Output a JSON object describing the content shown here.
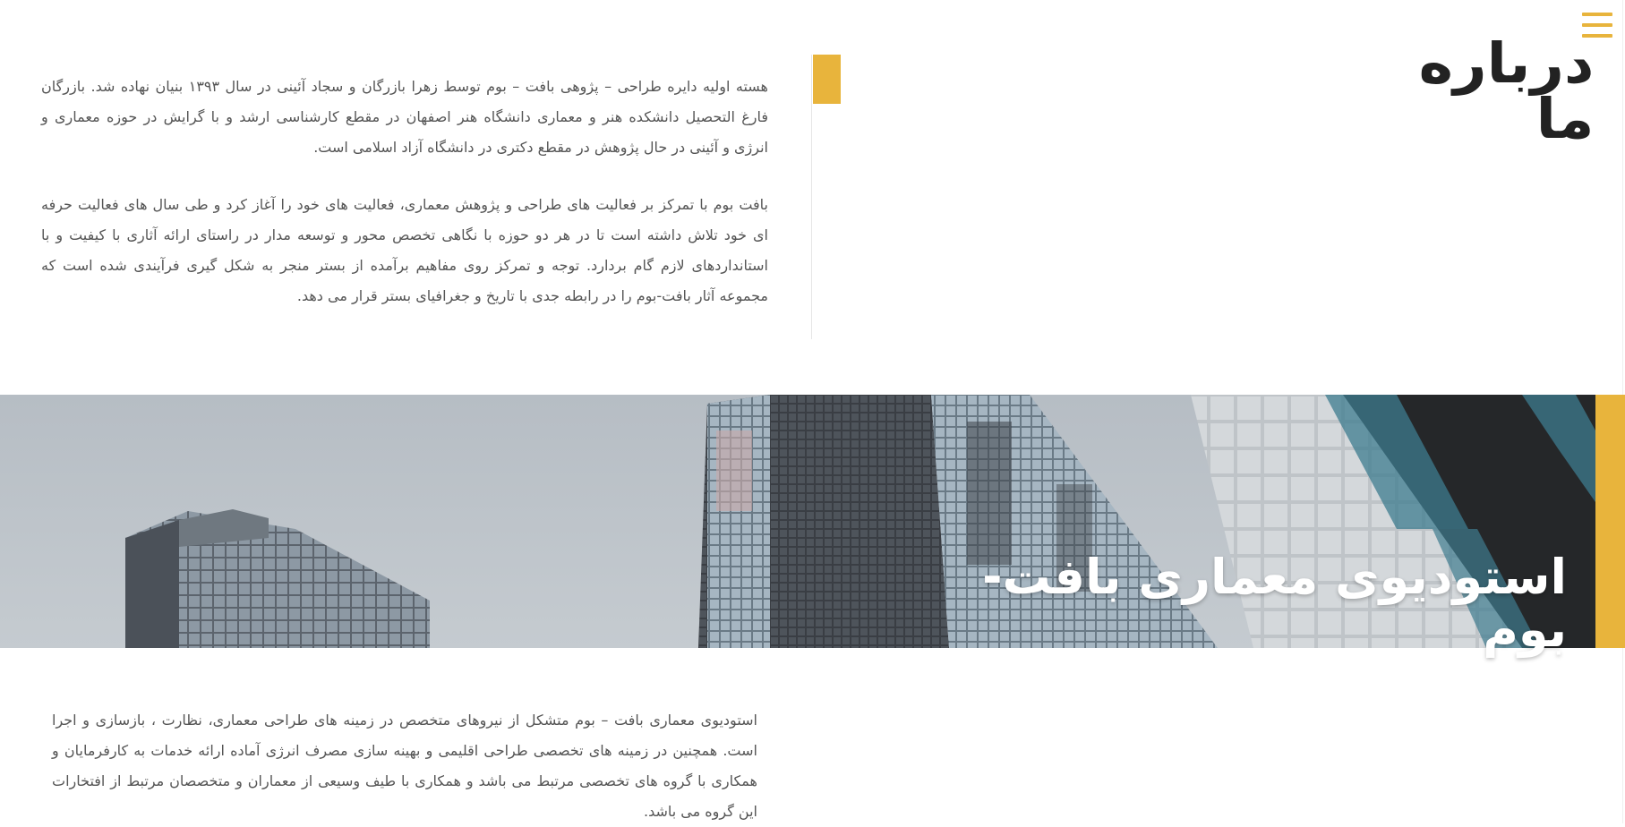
{
  "header": {
    "menu_icon": "hamburger-menu-icon"
  },
  "about": {
    "title": "درباره ما",
    "paragraphs": [
      "هسته اولیه دایره طراحی – پژوهی بافت – بوم توسط زهرا بازرگان و سجاد آئینی در سال ۱۳۹۳ بنیان نهاده شد. بازرگان فارغ التحصیل دانشکده هنر و معماری دانشگاه هنر اصفهان در مقطع کارشناسی ارشد و با گرایش در حوزه معماری و انرژی و آئینی در حال پژوهش در مقطع دکتری در دانشگاه آزاد اسلامی است.",
      "بافت بوم با تمرکز بر فعالیت های طراحی و پژوهش معماری، فعالیت های خود را آغاز کرد و طی سال های فعالیت حرفه ای خود تلاش داشته است تا در هر دو حوزه با نگاهی تخصص محور و توسعه مدار در راستای ارائه آثاری با کیفیت و با استانداردهای لازم گام بردارد. توجه و تمرکز روی مفاهیم برآمده از بستر منجر به شکل گیری فرآیندی شده است که مجموعه آثار بافت-بوم را در رابطه جدی با تاریخ و جغرافیای بستر قرار می دهد."
    ]
  },
  "banner": {
    "title": "استودیوی معماری بافت-بوم",
    "image_description": ""
  },
  "studio": {
    "paragraph": "استودیوی معماری بافت – بوم  متشکل از نیروهای متخصص در زمینه های طراحی معماری، نظارت ، بازسازی و اجرا است. همچنین در زمینه های تخصصی طراحی اقلیمی و بهینه سازی مصرف انرژی آماده ارائه خدمات به کارفرمایان و همکاری با گروه های تخصصی مرتبط می باشد و همکاری با طیف وسیعی از معماران و متخصصان مرتبط از افتخارات این گروه می باشد."
  },
  "colors": {
    "accent": "#e8b43c",
    "title_text": "#222222",
    "body_text": "#555555"
  }
}
